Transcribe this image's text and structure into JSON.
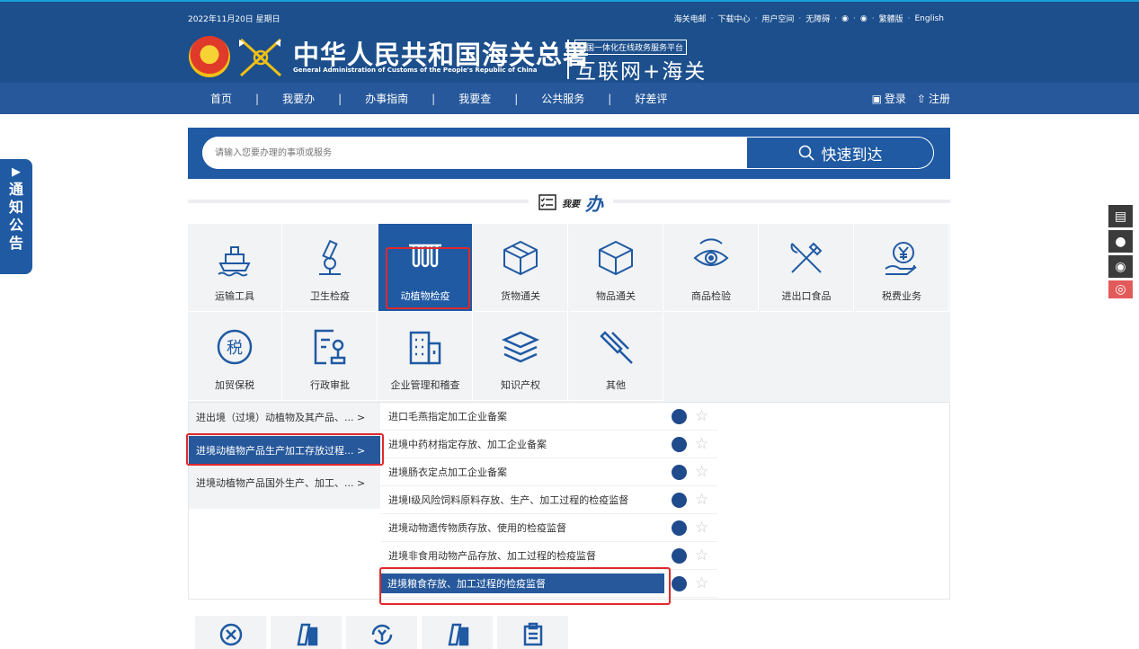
{
  "header": {
    "date": "2022年11月20日  星期日",
    "top_links": [
      "海关电邮",
      "下载中心",
      "用户空间",
      "无障碍",
      "繁體版",
      "English"
    ],
    "title_cn": "中华人民共和国海关总署",
    "title_en": "General Administration of Customs of the People's Republic of China",
    "platform_badge": "全国一体化在线政务服务平台",
    "platform_name": "互联网+海关"
  },
  "nav": {
    "items": [
      "首页",
      "我要办",
      "办事指南",
      "我要查",
      "公共服务",
      "好差评"
    ],
    "login": "登录",
    "register": "注册"
  },
  "notice_tab": {
    "chars": [
      "通",
      "知",
      "公",
      "告"
    ]
  },
  "search": {
    "placeholder": "请输入您要办理的事项或服务",
    "button": "快速到达"
  },
  "section": {
    "small": "我要",
    "big": "办"
  },
  "categories": [
    {
      "label": "运输工具",
      "icon": "ship-icon"
    },
    {
      "label": "卫生检疫",
      "icon": "microscope-icon"
    },
    {
      "label": "动植物检疫",
      "icon": "test-tubes-icon"
    },
    {
      "label": "货物通关",
      "icon": "cargo-box-icon"
    },
    {
      "label": "物品通关",
      "icon": "package-icon"
    },
    {
      "label": "商品检验",
      "icon": "eye-inspection-icon"
    },
    {
      "label": "进出口食品",
      "icon": "fork-knife-icon"
    },
    {
      "label": "税费业务",
      "icon": "yuan-hand-icon"
    },
    {
      "label": "加贸保税",
      "icon": "tax-badge-icon"
    },
    {
      "label": "行政审批",
      "icon": "approval-form-icon"
    },
    {
      "label": "企业管理和稽查",
      "icon": "building-icon"
    },
    {
      "label": "知识产权",
      "icon": "book-stack-icon"
    },
    {
      "label": "其他",
      "icon": "pin-icon"
    }
  ],
  "subcategories": [
    "进出境（过境）动植物及其产品、... >",
    "进境动植物产品生产加工存放过程... >",
    "进境动植物产品国外生产、加工、... >"
  ],
  "services": [
    "进口毛燕指定加工企业备案",
    "进境中药材指定存放、加工企业备案",
    "进境肠衣定点加工企业备案",
    "进境Ⅰ级风险饲料原料存放、生产、加工过程的检疫监督",
    "进境动物遗传物质存放、使用的检疫监督",
    "进境非食用动物产品存放、加工过程的检疫监督",
    "进境粮食存放、加工过程的检疫监督"
  ],
  "colors": {
    "primary": "#1f5aa3",
    "nav": "#26589b",
    "highlight": "#e0292b"
  }
}
